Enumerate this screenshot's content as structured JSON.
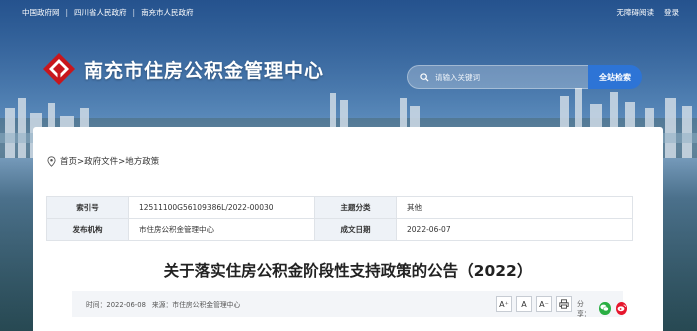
{
  "topbar": {
    "links": [
      "中国政府网",
      "四川省人民政府",
      "南充市人民政府"
    ],
    "right": [
      "无障碍阅读",
      "登录"
    ]
  },
  "site": {
    "title": "南充市住房公积金管理中心"
  },
  "search": {
    "placeholder": "请输入关键词",
    "button": "全站检索"
  },
  "breadcrumb": {
    "text": "首页>政府文件>地方政策"
  },
  "meta": {
    "index_label": "索引号",
    "index_value": "12511100G56109386L/2022-00030",
    "topic_label": "主题分类",
    "topic_value": "其他",
    "issuer_label": "发布机构",
    "issuer_value": "市住房公积金管理中心",
    "date_label": "成文日期",
    "date_value": "2022-06-07"
  },
  "document": {
    "title": "关于落实住房公积金阶段性支持政策的公告（2022）"
  },
  "info": {
    "time_text": "时间：2022-06-08",
    "source_text": "来源：市住房公积金管理中心",
    "font_large": "A⁺",
    "font_medium": "A",
    "font_small": "A⁻",
    "share_label": "分享："
  },
  "colors": {
    "accent": "#2d74d6",
    "logo_red": "#c8161d",
    "wechat": "#2aae43",
    "weibo": "#e6162d"
  }
}
